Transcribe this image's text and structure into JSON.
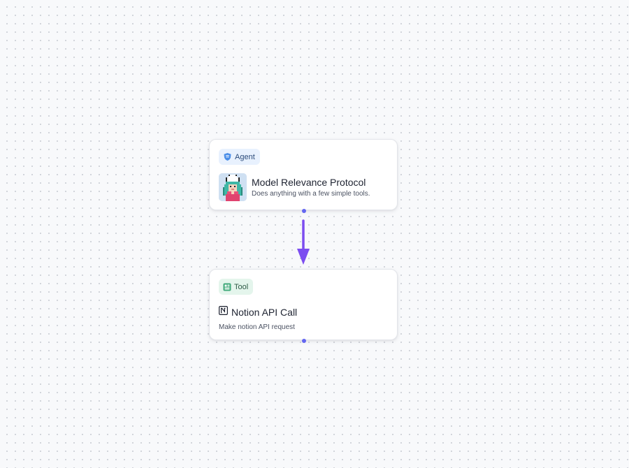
{
  "colors": {
    "handle": "#6366f1",
    "arrow": "#7c4df0",
    "agent_tag_bg": "#e8f1fe",
    "tool_tag_bg": "#e4f5ec"
  },
  "agent_node": {
    "tag_label": "Agent",
    "tag_icon": "agent-shield-icon",
    "avatar": "pixel-avatar",
    "title": "Model Relevance Protocol",
    "subtitle": "Does anything with a few simple tools."
  },
  "tool_node": {
    "tag_label": "Tool",
    "tag_icon": "tool-grid-icon",
    "title_icon": "notion-icon",
    "title": "Notion API Call",
    "description": "Make notion API request"
  },
  "edge": {
    "from": "Model Relevance Protocol",
    "to": "Notion API Call"
  }
}
